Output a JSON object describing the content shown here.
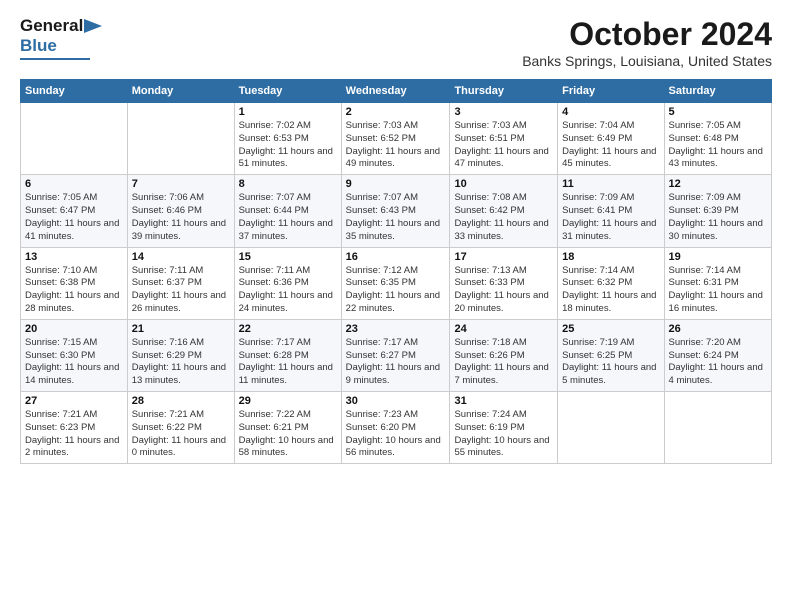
{
  "logo": {
    "line1": "General",
    "line2": "Blue"
  },
  "header": {
    "month": "October 2024",
    "location": "Banks Springs, Louisiana, United States"
  },
  "days_of_week": [
    "Sunday",
    "Monday",
    "Tuesday",
    "Wednesday",
    "Thursday",
    "Friday",
    "Saturday"
  ],
  "weeks": [
    [
      {
        "day": "",
        "info": ""
      },
      {
        "day": "",
        "info": ""
      },
      {
        "day": "1",
        "info": "Sunrise: 7:02 AM\nSunset: 6:53 PM\nDaylight: 11 hours and 51 minutes."
      },
      {
        "day": "2",
        "info": "Sunrise: 7:03 AM\nSunset: 6:52 PM\nDaylight: 11 hours and 49 minutes."
      },
      {
        "day": "3",
        "info": "Sunrise: 7:03 AM\nSunset: 6:51 PM\nDaylight: 11 hours and 47 minutes."
      },
      {
        "day": "4",
        "info": "Sunrise: 7:04 AM\nSunset: 6:49 PM\nDaylight: 11 hours and 45 minutes."
      },
      {
        "day": "5",
        "info": "Sunrise: 7:05 AM\nSunset: 6:48 PM\nDaylight: 11 hours and 43 minutes."
      }
    ],
    [
      {
        "day": "6",
        "info": "Sunrise: 7:05 AM\nSunset: 6:47 PM\nDaylight: 11 hours and 41 minutes."
      },
      {
        "day": "7",
        "info": "Sunrise: 7:06 AM\nSunset: 6:46 PM\nDaylight: 11 hours and 39 minutes."
      },
      {
        "day": "8",
        "info": "Sunrise: 7:07 AM\nSunset: 6:44 PM\nDaylight: 11 hours and 37 minutes."
      },
      {
        "day": "9",
        "info": "Sunrise: 7:07 AM\nSunset: 6:43 PM\nDaylight: 11 hours and 35 minutes."
      },
      {
        "day": "10",
        "info": "Sunrise: 7:08 AM\nSunset: 6:42 PM\nDaylight: 11 hours and 33 minutes."
      },
      {
        "day": "11",
        "info": "Sunrise: 7:09 AM\nSunset: 6:41 PM\nDaylight: 11 hours and 31 minutes."
      },
      {
        "day": "12",
        "info": "Sunrise: 7:09 AM\nSunset: 6:39 PM\nDaylight: 11 hours and 30 minutes."
      }
    ],
    [
      {
        "day": "13",
        "info": "Sunrise: 7:10 AM\nSunset: 6:38 PM\nDaylight: 11 hours and 28 minutes."
      },
      {
        "day": "14",
        "info": "Sunrise: 7:11 AM\nSunset: 6:37 PM\nDaylight: 11 hours and 26 minutes."
      },
      {
        "day": "15",
        "info": "Sunrise: 7:11 AM\nSunset: 6:36 PM\nDaylight: 11 hours and 24 minutes."
      },
      {
        "day": "16",
        "info": "Sunrise: 7:12 AM\nSunset: 6:35 PM\nDaylight: 11 hours and 22 minutes."
      },
      {
        "day": "17",
        "info": "Sunrise: 7:13 AM\nSunset: 6:33 PM\nDaylight: 11 hours and 20 minutes."
      },
      {
        "day": "18",
        "info": "Sunrise: 7:14 AM\nSunset: 6:32 PM\nDaylight: 11 hours and 18 minutes."
      },
      {
        "day": "19",
        "info": "Sunrise: 7:14 AM\nSunset: 6:31 PM\nDaylight: 11 hours and 16 minutes."
      }
    ],
    [
      {
        "day": "20",
        "info": "Sunrise: 7:15 AM\nSunset: 6:30 PM\nDaylight: 11 hours and 14 minutes."
      },
      {
        "day": "21",
        "info": "Sunrise: 7:16 AM\nSunset: 6:29 PM\nDaylight: 11 hours and 13 minutes."
      },
      {
        "day": "22",
        "info": "Sunrise: 7:17 AM\nSunset: 6:28 PM\nDaylight: 11 hours and 11 minutes."
      },
      {
        "day": "23",
        "info": "Sunrise: 7:17 AM\nSunset: 6:27 PM\nDaylight: 11 hours and 9 minutes."
      },
      {
        "day": "24",
        "info": "Sunrise: 7:18 AM\nSunset: 6:26 PM\nDaylight: 11 hours and 7 minutes."
      },
      {
        "day": "25",
        "info": "Sunrise: 7:19 AM\nSunset: 6:25 PM\nDaylight: 11 hours and 5 minutes."
      },
      {
        "day": "26",
        "info": "Sunrise: 7:20 AM\nSunset: 6:24 PM\nDaylight: 11 hours and 4 minutes."
      }
    ],
    [
      {
        "day": "27",
        "info": "Sunrise: 7:21 AM\nSunset: 6:23 PM\nDaylight: 11 hours and 2 minutes."
      },
      {
        "day": "28",
        "info": "Sunrise: 7:21 AM\nSunset: 6:22 PM\nDaylight: 11 hours and 0 minutes."
      },
      {
        "day": "29",
        "info": "Sunrise: 7:22 AM\nSunset: 6:21 PM\nDaylight: 10 hours and 58 minutes."
      },
      {
        "day": "30",
        "info": "Sunrise: 7:23 AM\nSunset: 6:20 PM\nDaylight: 10 hours and 56 minutes."
      },
      {
        "day": "31",
        "info": "Sunrise: 7:24 AM\nSunset: 6:19 PM\nDaylight: 10 hours and 55 minutes."
      },
      {
        "day": "",
        "info": ""
      },
      {
        "day": "",
        "info": ""
      }
    ]
  ]
}
